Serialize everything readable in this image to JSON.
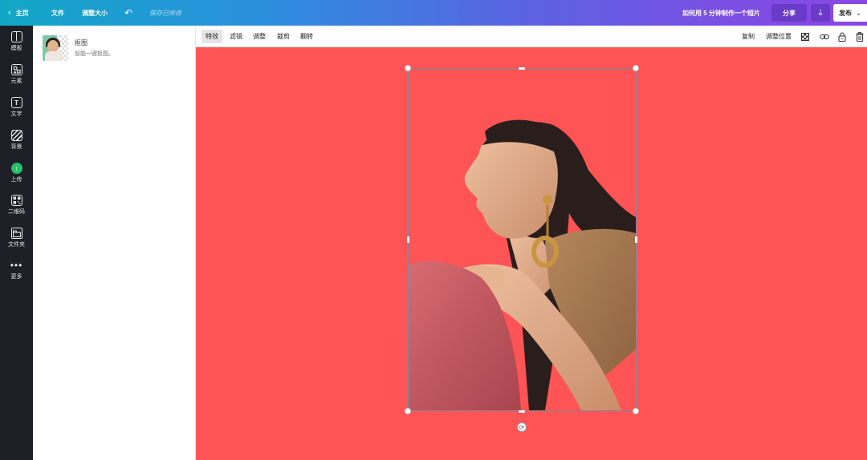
{
  "topbar": {
    "home_label": "主页",
    "file_label": "文件",
    "resize_label": "调整大小",
    "saved_status": "保存已修改",
    "promo_text": "如何用 5 分钟制作一个短片",
    "share_label": "分享",
    "publish_label": "发布",
    "colors": {
      "gradient_start": "#12a7c6",
      "gradient_end": "#8a47e3"
    }
  },
  "sidebar": {
    "items": [
      {
        "label": "模板",
        "icon": "template-icon"
      },
      {
        "label": "元素",
        "icon": "elements-icon"
      },
      {
        "label": "文字",
        "icon": "text-icon",
        "glyph": "T"
      },
      {
        "label": "背景",
        "icon": "background-icon"
      },
      {
        "label": "上传",
        "icon": "upload-icon"
      },
      {
        "label": "二维码",
        "icon": "qrcode-icon"
      },
      {
        "label": "文件夹",
        "icon": "folder-icon"
      },
      {
        "label": "更多",
        "icon": "more-icon"
      }
    ]
  },
  "panel": {
    "card": {
      "title": "抠图",
      "subtitle": "智能一键抠图。"
    }
  },
  "toolbar": {
    "tools": [
      "特效",
      "滤镜",
      "调整",
      "裁剪",
      "翻转"
    ],
    "active_tool": "特效",
    "copy_label": "复制",
    "position_label": "调整位置"
  },
  "canvas": {
    "background_color": "#fe5455",
    "selection": "image"
  }
}
